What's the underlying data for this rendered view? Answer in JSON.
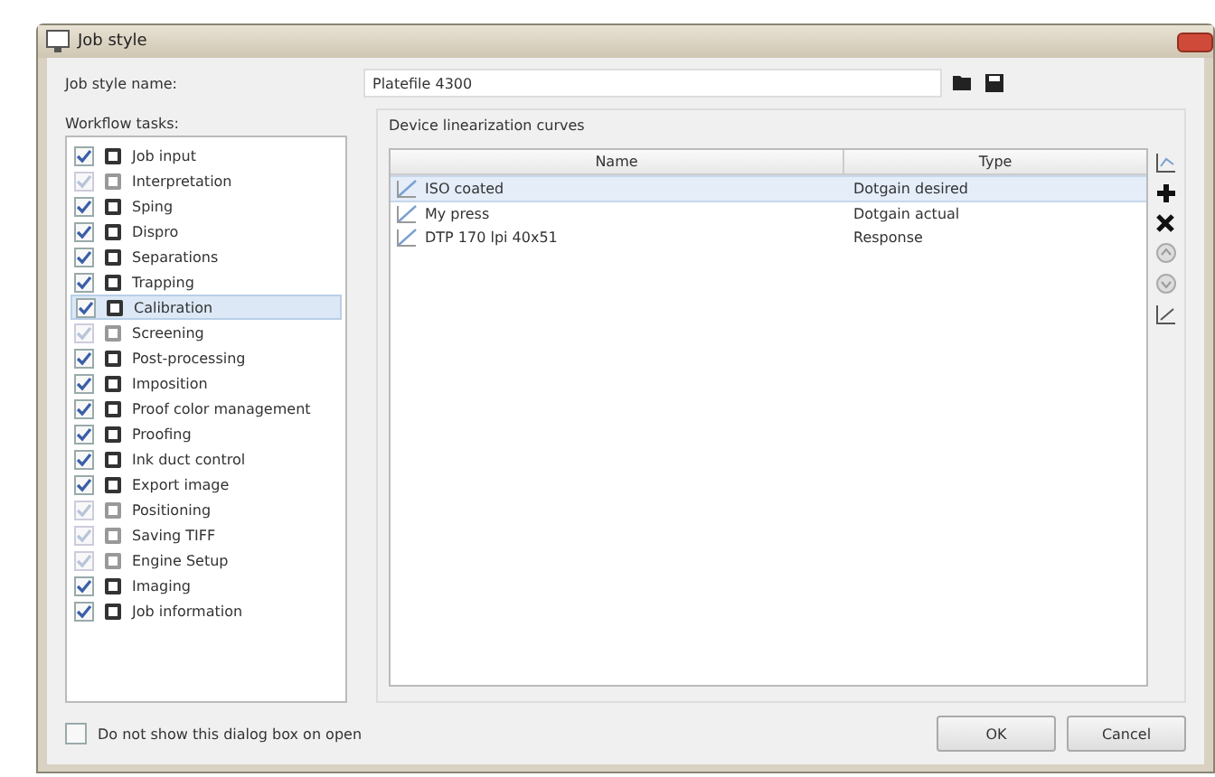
{
  "window": {
    "title": "Job style"
  },
  "job_style_name": {
    "label": "Job style name:",
    "value": "Platefile 4300"
  },
  "workflow_tasks": {
    "label": "Workflow tasks:",
    "items": [
      {
        "label": "Job input",
        "checked": true,
        "disabled": false,
        "selected": false
      },
      {
        "label": "Interpretation",
        "checked": true,
        "disabled": true,
        "selected": false
      },
      {
        "label": "Sping",
        "checked": true,
        "disabled": false,
        "selected": false
      },
      {
        "label": "Dispro",
        "checked": true,
        "disabled": false,
        "selected": false
      },
      {
        "label": "Separations",
        "checked": true,
        "disabled": false,
        "selected": false
      },
      {
        "label": "Trapping",
        "checked": true,
        "disabled": false,
        "selected": false
      },
      {
        "label": "Calibration",
        "checked": true,
        "disabled": false,
        "selected": true
      },
      {
        "label": "Screening",
        "checked": true,
        "disabled": true,
        "selected": false
      },
      {
        "label": "Post-processing",
        "checked": true,
        "disabled": false,
        "selected": false
      },
      {
        "label": "Imposition",
        "checked": true,
        "disabled": false,
        "selected": false
      },
      {
        "label": "Proof color management",
        "checked": true,
        "disabled": false,
        "selected": false
      },
      {
        "label": "Proofing",
        "checked": true,
        "disabled": false,
        "selected": false
      },
      {
        "label": "Ink duct control",
        "checked": true,
        "disabled": false,
        "selected": false
      },
      {
        "label": "Export image",
        "checked": true,
        "disabled": false,
        "selected": false
      },
      {
        "label": "Positioning",
        "checked": true,
        "disabled": true,
        "selected": false
      },
      {
        "label": "Saving TIFF",
        "checked": true,
        "disabled": true,
        "selected": false
      },
      {
        "label": "Engine Setup",
        "checked": true,
        "disabled": true,
        "selected": false
      },
      {
        "label": "Imaging",
        "checked": true,
        "disabled": false,
        "selected": false
      },
      {
        "label": "Job information",
        "checked": true,
        "disabled": false,
        "selected": false
      }
    ]
  },
  "curves": {
    "title": "Device linearization curves",
    "columns": [
      "Name",
      "Type"
    ],
    "rows": [
      {
        "name": "ISO coated",
        "type": "Dotgain desired",
        "selected": true
      },
      {
        "name": "My press",
        "type": "Dotgain actual",
        "selected": false
      },
      {
        "name": "DTP 170 lpi 40x51",
        "type": "Response",
        "selected": false
      }
    ]
  },
  "dont_show": {
    "label": "Do not show this dialog box on open",
    "checked": false
  },
  "buttons": [
    "OK",
    "Cancel"
  ]
}
